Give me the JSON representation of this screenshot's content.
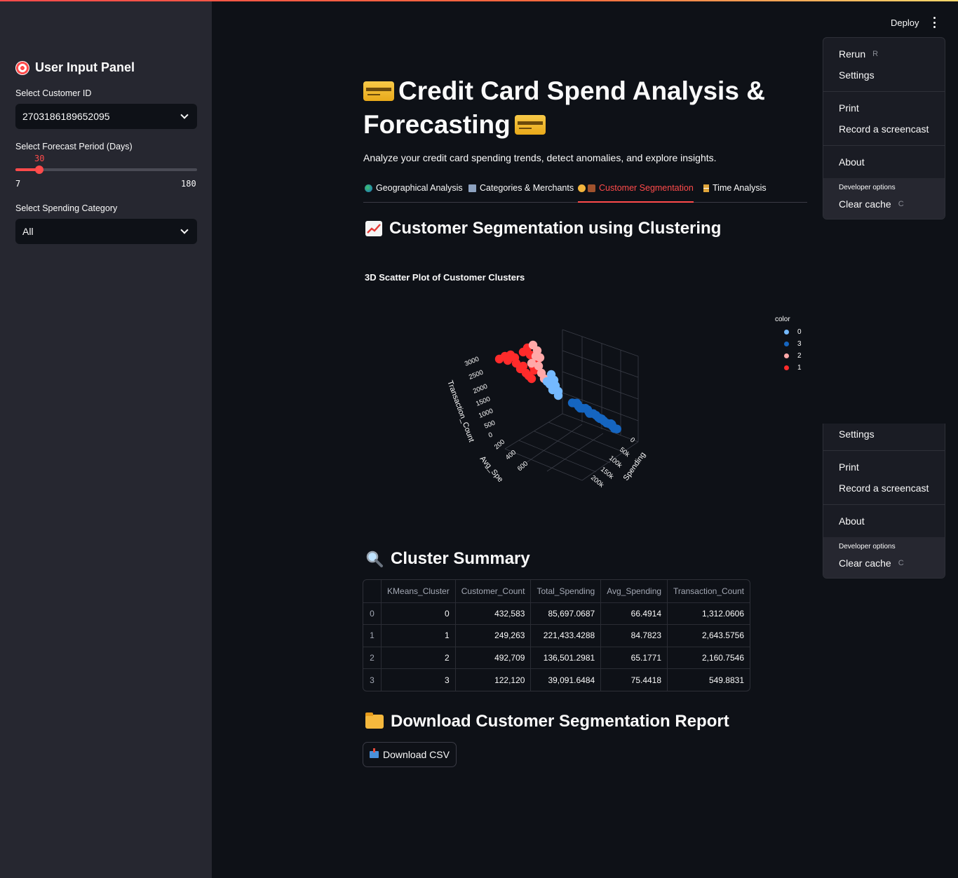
{
  "header": {
    "deploy_label": "Deploy"
  },
  "sidebar": {
    "title": "User Input Panel",
    "customer_label": "Select Customer ID",
    "customer_value": "2703186189652095",
    "forecast_label": "Select Forecast Period (Days)",
    "forecast_value": 30,
    "forecast_value_text": "30",
    "forecast_min": "7",
    "forecast_max": "180",
    "category_label": "Select Spending Category",
    "category_value": "All"
  },
  "main": {
    "title_line1": "Credit Card Spend Analysis &",
    "title_line2": "Forecasting",
    "subtitle": "Analyze your credit card spending trends, detect anomalies, and explore insights.",
    "tabs": [
      {
        "label": "Geographical Analysis"
      },
      {
        "label": "Categories & Merchants"
      },
      {
        "label": "Customer Segmentation"
      },
      {
        "label": "Time Analysis"
      }
    ],
    "active_tab": 2,
    "section_heading": "Customer Segmentation using Clustering",
    "plot_title": "3D Scatter Plot of Customer Clusters",
    "summary_heading": "Cluster Summary",
    "download_heading": "Download Customer Segmentation Report",
    "download_button": "Download CSV"
  },
  "chart_data": {
    "type": "scatter",
    "dimensions": "3d",
    "title": "3D Scatter Plot of Customer Clusters",
    "axes": {
      "x": {
        "label": "Avg_Spe",
        "ticks": [
          "200",
          "400",
          "600"
        ]
      },
      "y": {
        "label": "Spending",
        "ticks": [
          "0",
          "50k",
          "100k",
          "150k",
          "200k"
        ]
      },
      "z": {
        "label": "Transaction_Count",
        "ticks": [
          "0",
          "500",
          "1000",
          "1500",
          "2000",
          "2500",
          "3000"
        ]
      }
    },
    "legend": {
      "title": "color",
      "placement": "top-right",
      "entries": [
        {
          "name": "0",
          "color": "#74b9ff"
        },
        {
          "name": "3",
          "color": "#1565c0"
        },
        {
          "name": "2",
          "color": "#ffa8a8"
        },
        {
          "name": "1",
          "color": "#ff2b2b"
        }
      ]
    }
  },
  "table": {
    "columns": [
      "",
      "KMeans_Cluster",
      "Customer_Count",
      "Total_Spending",
      "Avg_Spending",
      "Transaction_Count"
    ],
    "rows": [
      [
        "0",
        "0",
        "432,583",
        "85,697.0687",
        "66.4914",
        "1,312.0606"
      ],
      [
        "1",
        "1",
        "249,263",
        "221,433.4288",
        "84.7823",
        "2,643.5756"
      ],
      [
        "2",
        "2",
        "492,709",
        "136,501.2981",
        "65.1771",
        "2,160.7546"
      ],
      [
        "3",
        "3",
        "122,120",
        "39,091.6484",
        "75.4418",
        "549.8831"
      ]
    ]
  },
  "menu": {
    "rerun": "Rerun",
    "rerun_key": "R",
    "settings": "Settings",
    "print": "Print",
    "record": "Record a screencast",
    "about": "About",
    "dev_title": "Developer options",
    "clear_cache": "Clear cache",
    "clear_key": "C"
  },
  "colors": {
    "accent": "#ff4b4b",
    "background": "#0e1117",
    "sidebar": "#262730"
  }
}
